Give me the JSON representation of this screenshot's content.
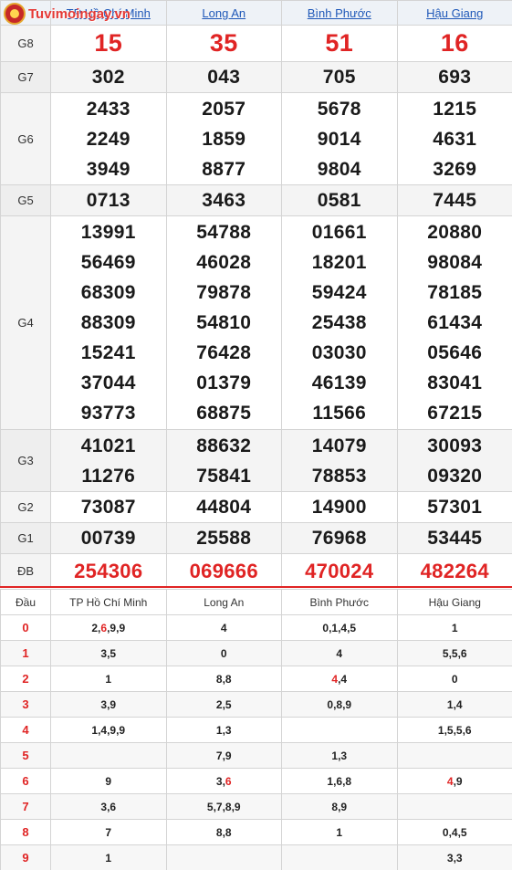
{
  "logo": {
    "text": "Tuvimoingay.vn"
  },
  "provinces": [
    "TP Hồ Chí Minh",
    "Long An",
    "Bình Phước",
    "Hậu Giang"
  ],
  "prizes": [
    {
      "label": "G8",
      "rows": [
        [
          "15",
          "35",
          "51",
          "16"
        ]
      ]
    },
    {
      "label": "G7",
      "rows": [
        [
          "302",
          "043",
          "705",
          "693"
        ]
      ]
    },
    {
      "label": "G6",
      "rows": [
        [
          "2433",
          "2057",
          "5678",
          "1215"
        ],
        [
          "2249",
          "1859",
          "9014",
          "4631"
        ],
        [
          "3949",
          "8877",
          "9804",
          "3269"
        ]
      ]
    },
    {
      "label": "G5",
      "rows": [
        [
          "0713",
          "3463",
          "0581",
          "7445"
        ]
      ]
    },
    {
      "label": "G4",
      "rows": [
        [
          "13991",
          "54788",
          "01661",
          "20880"
        ],
        [
          "56469",
          "46028",
          "18201",
          "98084"
        ],
        [
          "68309",
          "79878",
          "59424",
          "78185"
        ],
        [
          "88309",
          "54810",
          "25438",
          "61434"
        ],
        [
          "15241",
          "76428",
          "03030",
          "05646"
        ],
        [
          "37044",
          "01379",
          "46139",
          "83041"
        ],
        [
          "93773",
          "68875",
          "11566",
          "67215"
        ]
      ]
    },
    {
      "label": "G3",
      "rows": [
        [
          "41021",
          "88632",
          "14079",
          "30093"
        ],
        [
          "11276",
          "75841",
          "78853",
          "09320"
        ]
      ]
    },
    {
      "label": "G2",
      "rows": [
        [
          "73087",
          "44804",
          "14900",
          "57301"
        ]
      ]
    },
    {
      "label": "G1",
      "rows": [
        [
          "00739",
          "25588",
          "76968",
          "53445"
        ]
      ]
    },
    {
      "label": "ĐB",
      "rows": [
        [
          "254306",
          "069666",
          "470024",
          "482264"
        ]
      ]
    }
  ],
  "dau_table": {
    "header": [
      "Đầu",
      "TP Hồ Chí Minh",
      "Long An",
      "Bình Phước",
      "Hậu Giang"
    ],
    "rows": [
      {
        "key": "0",
        "cells": [
          "2,6,9,9",
          "4",
          "0,1,4,5",
          "1"
        ]
      },
      {
        "key": "1",
        "cells": [
          "3,5",
          "0",
          "4",
          "5,5,6"
        ]
      },
      {
        "key": "2",
        "cells": [
          "1",
          "8,8",
          "4,4",
          "0"
        ]
      },
      {
        "key": "3",
        "cells": [
          "3,9",
          "2,5",
          "0,8,9",
          "1,4"
        ]
      },
      {
        "key": "4",
        "cells": [
          "1,4,9,9",
          "1,3",
          "",
          "1,5,5,6"
        ]
      },
      {
        "key": "5",
        "cells": [
          "",
          "7,9",
          "1,3",
          ""
        ]
      },
      {
        "key": "6",
        "cells": [
          "9",
          "3,6",
          "1,6,8",
          "4,9"
        ]
      },
      {
        "key": "7",
        "cells": [
          "3,6",
          "5,7,8,9",
          "8,9",
          ""
        ]
      },
      {
        "key": "8",
        "cells": [
          "7",
          "8,8",
          "1",
          "0,4,5"
        ]
      },
      {
        "key": "9",
        "cells": [
          "1",
          "",
          "",
          "3,3"
        ]
      }
    ],
    "highlight": {
      "0-0": 1,
      "2-2": 0,
      "6-1": 1,
      "6-3": 0
    }
  },
  "colors": {
    "accent_red": "#e02424",
    "link_blue": "#1f58b8",
    "divider": "#e02424"
  }
}
